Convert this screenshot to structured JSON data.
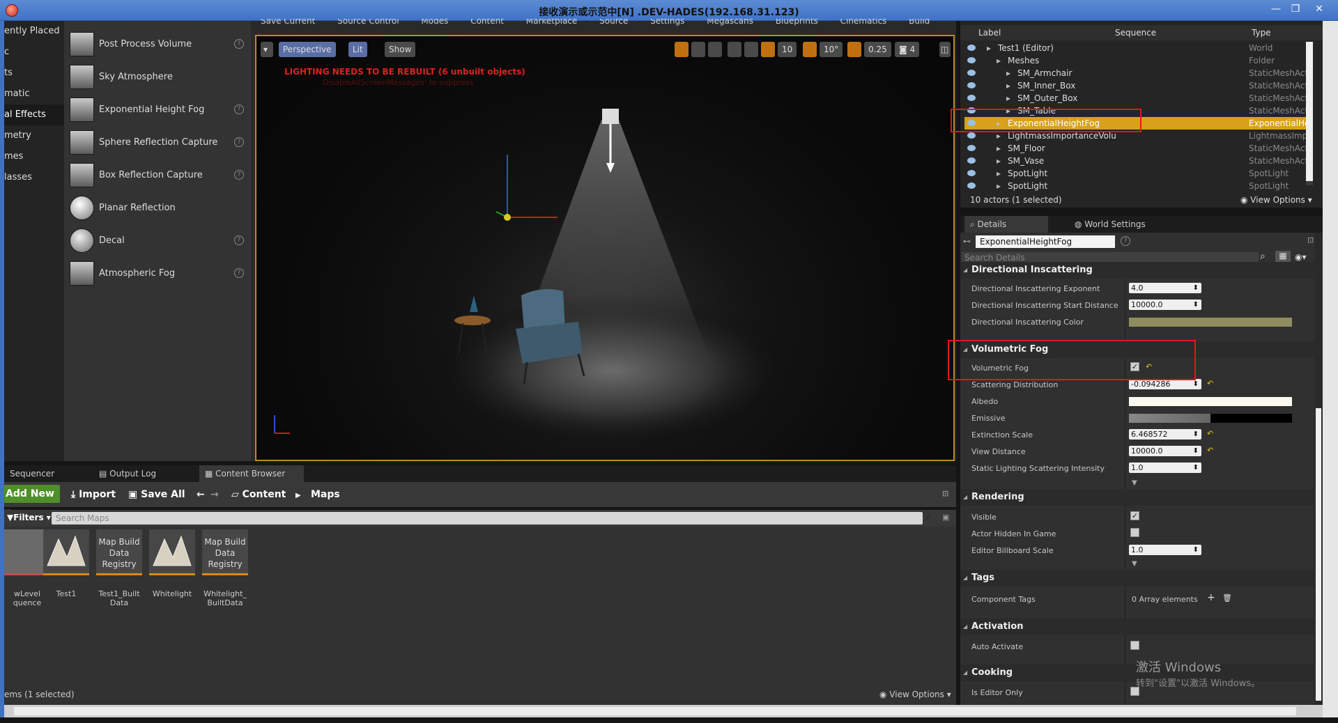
{
  "window": {
    "title": "接收演示或示范中[N] .DEV-HADES(192.168.31.123)"
  },
  "left_panel": {
    "categories": [
      "ently Placed",
      "c",
      "ts",
      "matic",
      "al Effects",
      "metry",
      "mes",
      "lasses"
    ],
    "active_category": "al Effects",
    "place_items": [
      {
        "label": "Post Process Volume",
        "help": true
      },
      {
        "label": "Sky Atmosphere",
        "help": false
      },
      {
        "label": "Exponential Height Fog",
        "help": true
      },
      {
        "label": "Sphere Reflection Capture",
        "help": true
      },
      {
        "label": "Box Reflection Capture",
        "help": true
      },
      {
        "label": "Planar Reflection",
        "help": false
      },
      {
        "label": "Decal",
        "help": true
      },
      {
        "label": "Atmospheric Fog",
        "help": true
      }
    ]
  },
  "top_menu": [
    "Save Current",
    "Source Control",
    "Modes",
    "Content",
    "Marketplace",
    "Source",
    "Settings",
    "Megascans",
    "Blueprints",
    "Cinematics",
    "Build"
  ],
  "viewport": {
    "perspective_label": "Perspective",
    "lit_label": "Lit",
    "show_label": "Show",
    "grid_snap": "10",
    "rotation_snap": "10°",
    "scale_snap": "0.25",
    "camera_speed": "4",
    "warning": "LIGHTING NEEDS TO BE REBUILT (6 unbuilt objects)",
    "warning_sub": "DisableAllScreenMessages' to suppress"
  },
  "content_browser": {
    "tabs": [
      "Sequencer",
      "Output Log",
      "Content Browser"
    ],
    "add_new": "Add New",
    "import": "Import",
    "save_all": "Save All",
    "path": [
      "Content",
      "Maps"
    ],
    "filters": "Filters",
    "search_placeholder": "Search Maps",
    "assets": [
      {
        "thumb_text": "",
        "label": "wLevel\nquence"
      },
      {
        "thumb_text": "",
        "label": "Test1"
      },
      {
        "thumb_text": "Map Build\nData\nRegistry",
        "label": "Test1_Built\nData"
      },
      {
        "thumb_text": "",
        "label": "Whitelight"
      },
      {
        "thumb_text": "Map Build\nData\nRegistry",
        "label": "Whitelight_\nBuiltData"
      }
    ],
    "status": "ems (1 selected)",
    "view_options": "View Options"
  },
  "outliner": {
    "col_label": "Label",
    "col_sequence": "Sequence",
    "col_type": "Type",
    "rows": [
      {
        "name": "Test1 (Editor)",
        "type": "World",
        "indent": 1,
        "selected": false
      },
      {
        "name": "Meshes",
        "type": "Folder",
        "indent": 2,
        "selected": false
      },
      {
        "name": "SM_Armchair",
        "type": "StaticMeshAct",
        "indent": 3,
        "selected": false
      },
      {
        "name": "SM_Inner_Box",
        "type": "StaticMeshAct",
        "indent": 3,
        "selected": false
      },
      {
        "name": "SM_Outer_Box",
        "type": "StaticMeshAct",
        "indent": 3,
        "selected": false
      },
      {
        "name": "SM_Table",
        "type": "StaticMeshAct",
        "indent": 3,
        "selected": false
      },
      {
        "name": "ExponentialHeightFog",
        "type": "ExponentialHe",
        "indent": 2,
        "selected": true
      },
      {
        "name": "LightmassImportanceVolu",
        "type": "LightmassImp",
        "indent": 2,
        "selected": false
      },
      {
        "name": "SM_Floor",
        "type": "StaticMeshAct",
        "indent": 2,
        "selected": false
      },
      {
        "name": "SM_Vase",
        "type": "StaticMeshAct",
        "indent": 2,
        "selected": false
      },
      {
        "name": "SpotLight",
        "type": "SpotLight",
        "indent": 2,
        "selected": false
      },
      {
        "name": "SpotLight",
        "type": "SpotLight",
        "indent": 2,
        "selected": false
      }
    ],
    "status": "10 actors (1 selected)",
    "view_options": "View Options"
  },
  "details": {
    "tab_details": "Details",
    "tab_world": "World Settings",
    "actor_name": "ExponentialHeightFog",
    "search_placeholder": "Search Details",
    "sections": {
      "directional": "Directional Inscattering",
      "volumetric": "Volumetric Fog",
      "rendering": "Rendering",
      "tags": "Tags",
      "activation": "Activation",
      "cooking": "Cooking"
    },
    "props": {
      "dir_exponent_label": "Directional Inscattering Exponent",
      "dir_exponent": "4.0",
      "dir_start_label": "Directional Inscattering Start Distance",
      "dir_start": "10000.0",
      "dir_color_label": "Directional Inscattering Color",
      "vol_fog_label": "Volumetric Fog",
      "scattering_label": "Scattering Distribution",
      "scattering": "-0.094286",
      "albedo_label": "Albedo",
      "emissive_label": "Emissive",
      "extinction_label": "Extinction Scale",
      "extinction": "6.468572",
      "view_distance_label": "View Distance",
      "view_distance": "10000.0",
      "static_scatter_label": "Static Lighting Scattering Intensity",
      "static_scatter": "1.0",
      "visible_label": "Visible",
      "hidden_label": "Actor Hidden In Game",
      "billboard_label": "Editor Billboard Scale",
      "billboard": "1.0",
      "tags_label": "Component Tags",
      "tags_value": "0 Array elements",
      "auto_activate_label": "Auto Activate",
      "editor_only_label": "Is Editor Only"
    }
  },
  "watermark": {
    "line1": "激活 Windows",
    "line2": "转到\"设置\"以激活 Windows。"
  },
  "colors": {
    "accent_selected": "#d7a11a",
    "viewport_border": "#c08a1a",
    "add_new_green": "#4f8f2a",
    "annotation_red": "#e01818"
  }
}
